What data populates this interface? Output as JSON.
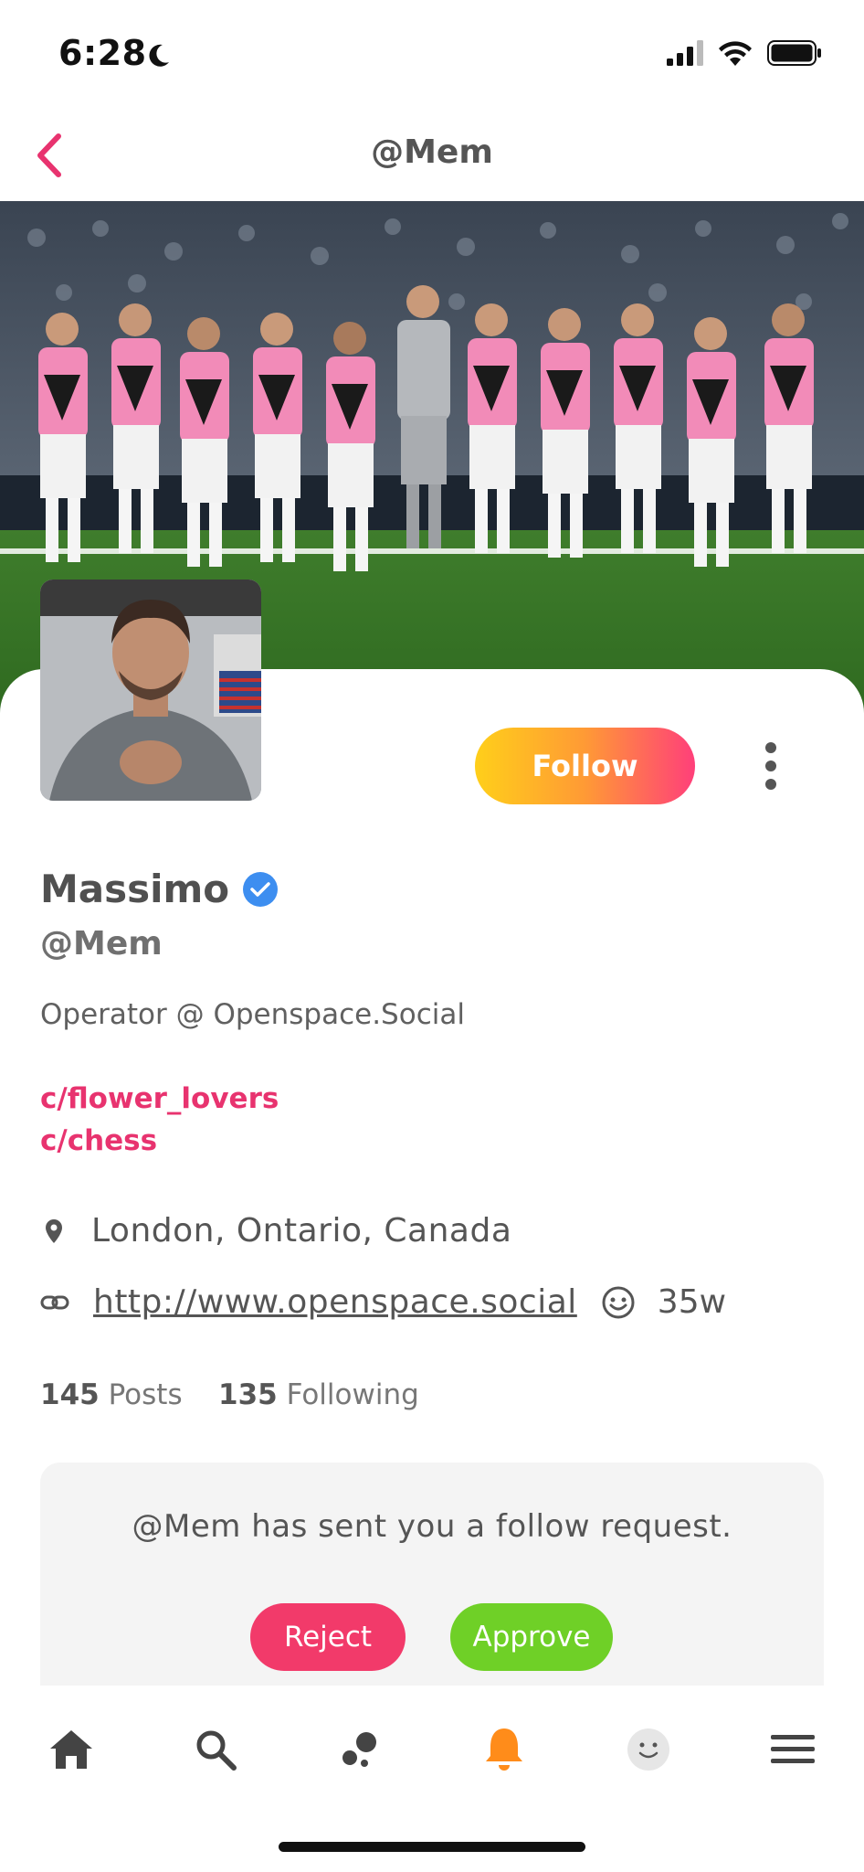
{
  "status_bar": {
    "time": "6:28"
  },
  "header": {
    "title": "@Mem"
  },
  "profile": {
    "name": "Massimo",
    "handle": "@Mem",
    "bio": "Operator @ Openspace.Social",
    "communities": [
      "c/flower_lovers",
      "c/chess"
    ],
    "location": "London, Ontario, Canada",
    "website": "http://www.openspace.social",
    "age": "35w",
    "stats": {
      "posts_count": "145",
      "posts_label": "Posts",
      "following_count": "135",
      "following_label": "Following"
    }
  },
  "actions": {
    "follow_label": "Follow"
  },
  "follow_request": {
    "message": "@Mem has sent you a follow request.",
    "reject_label": "Reject",
    "approve_label": "Approve"
  },
  "colors": {
    "accent": "#e8336f",
    "follow_gradient_start": "#ffcf1a",
    "follow_gradient_end": "#ff3f7a",
    "reject": "#f23a6a",
    "approve": "#6fd027",
    "notification_active": "#ff8c1a"
  },
  "tab_bar": {
    "tabs": [
      "home-icon",
      "search-icon",
      "communities-icon",
      "notifications-icon",
      "profile-face-icon",
      "menu-icon"
    ],
    "active": "notifications-icon"
  }
}
